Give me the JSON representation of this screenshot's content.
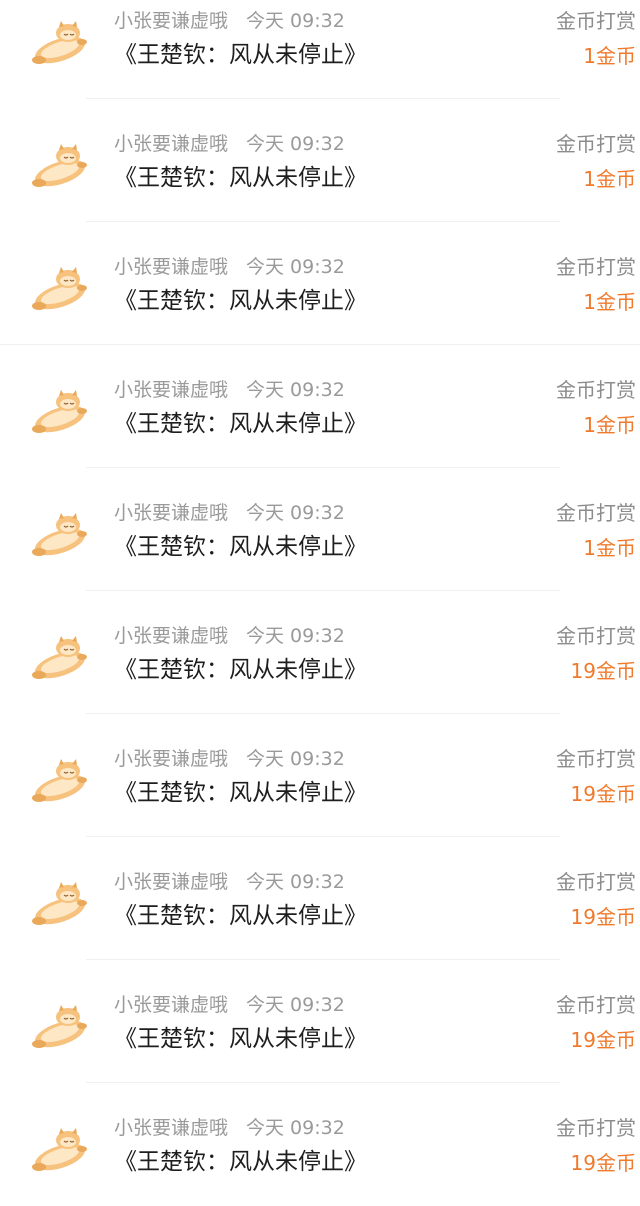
{
  "items": [
    {
      "user": "小张要谦虚哦",
      "time": "今天 09:32",
      "book": "《王楚钦：风从未停止》",
      "action": "金币打赏",
      "amount": "1金币",
      "avatar_icon": "sleeping-cat-icon"
    },
    {
      "user": "小张要谦虚哦",
      "time": "今天 09:32",
      "book": "《王楚钦：风从未停止》",
      "action": "金币打赏",
      "amount": "1金币",
      "avatar_icon": "sleeping-cat-icon"
    },
    {
      "user": "小张要谦虚哦",
      "time": "今天 09:32",
      "book": "《王楚钦：风从未停止》",
      "action": "金币打赏",
      "amount": "1金币",
      "avatar_icon": "sleeping-cat-icon"
    },
    {
      "user": "小张要谦虚哦",
      "time": "今天 09:32",
      "book": "《王楚钦：风从未停止》",
      "action": "金币打赏",
      "amount": "1金币",
      "avatar_icon": "sleeping-cat-icon"
    },
    {
      "user": "小张要谦虚哦",
      "time": "今天 09:32",
      "book": "《王楚钦：风从未停止》",
      "action": "金币打赏",
      "amount": "1金币",
      "avatar_icon": "sleeping-cat-icon"
    },
    {
      "user": "小张要谦虚哦",
      "time": "今天 09:32",
      "book": "《王楚钦：风从未停止》",
      "action": "金币打赏",
      "amount": "19金币",
      "avatar_icon": "sleeping-cat-icon"
    },
    {
      "user": "小张要谦虚哦",
      "time": "今天 09:32",
      "book": "《王楚钦：风从未停止》",
      "action": "金币打赏",
      "amount": "19金币",
      "avatar_icon": "sleeping-cat-icon"
    },
    {
      "user": "小张要谦虚哦",
      "time": "今天 09:32",
      "book": "《王楚钦：风从未停止》",
      "action": "金币打赏",
      "amount": "19金币",
      "avatar_icon": "sleeping-cat-icon"
    },
    {
      "user": "小张要谦虚哦",
      "time": "今天 09:32",
      "book": "《王楚钦：风从未停止》",
      "action": "金币打赏",
      "amount": "19金币",
      "avatar_icon": "sleeping-cat-icon"
    },
    {
      "user": "小张要谦虚哦",
      "time": "今天 09:32",
      "book": "《王楚钦：风从未停止》",
      "action": "金币打赏",
      "amount": "19金币",
      "avatar_icon": "sleeping-cat-icon"
    }
  ],
  "colors": {
    "amount": "#f07a2c",
    "secondary_text": "#9a9a9a",
    "primary_text": "#1e1e1e",
    "avatar_fill": "#f6c27e",
    "avatar_light": "#fde7c4"
  }
}
